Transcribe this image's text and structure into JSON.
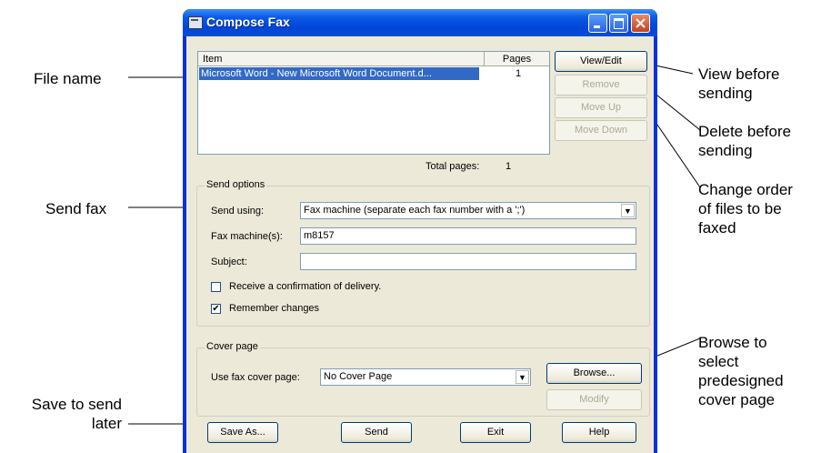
{
  "annotations": {
    "file_name": "File name",
    "send_fax": "Send fax",
    "save_later": [
      "Save to send",
      "later"
    ],
    "view_before": [
      "View before",
      "sending"
    ],
    "delete_before": [
      "Delete before",
      "sending"
    ],
    "change_order": [
      "Change order",
      "of files to be",
      "faxed"
    ],
    "browse_cover": [
      "Browse to",
      "select",
      "predesigned",
      "cover page"
    ]
  },
  "window": {
    "title": "Compose Fax"
  },
  "list": {
    "col_item": "Item",
    "col_pages": "Pages",
    "rows": [
      {
        "item": "Microsoft Word - New Microsoft Word Document.d...",
        "pages": "1"
      }
    ],
    "total_label": "Total pages:",
    "total_value": "1"
  },
  "buttons": {
    "view_edit": "View/Edit",
    "remove": "Remove",
    "move_up": "Move Up",
    "move_down": "Move Down",
    "browse": "Browse...",
    "modify": "Modify",
    "save_as": "Save As...",
    "send": "Send",
    "exit": "Exit",
    "help": "Help"
  },
  "send_options": {
    "legend": "Send options",
    "send_using_label": "Send using:",
    "send_using_value": "Fax machine (separate each fax number with a ';')",
    "fax_machine_label": "Fax machine(s):",
    "fax_machine_value": "m8157",
    "subject_label": "Subject:",
    "subject_value": "",
    "receive_confirmation_label": "Receive a confirmation of delivery.",
    "receive_confirmation_checked": false,
    "remember_changes_label": "Remember changes",
    "remember_changes_checked": true
  },
  "cover_page": {
    "legend": "Cover page",
    "use_label": "Use fax cover page:",
    "use_value": "No Cover Page"
  }
}
